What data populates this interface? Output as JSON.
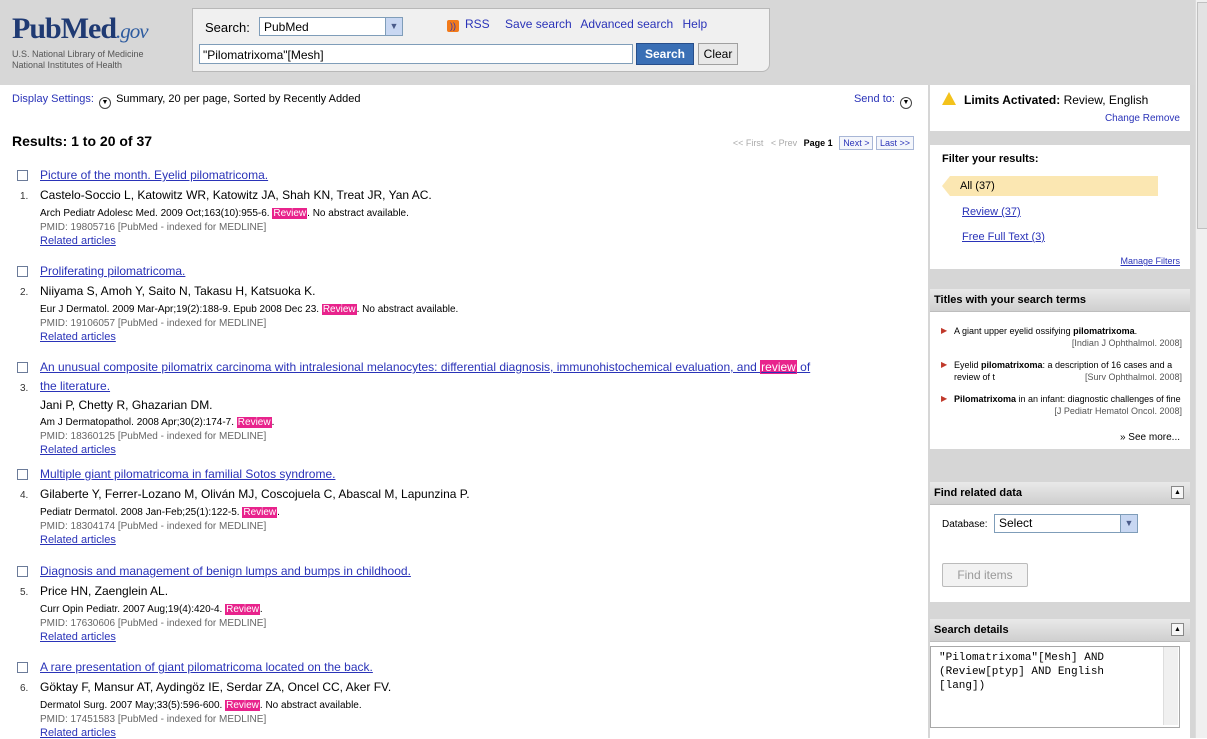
{
  "header": {
    "logo_pub": "Pub",
    "logo_med": "Med",
    "logo_gov": ".gov",
    "logo_sub1": "U.S. National Library of Medicine",
    "logo_sub2": "National Institutes of Health",
    "search_label": "Search:",
    "database": "PubMed",
    "links": [
      "RSS",
      "Save search",
      "Advanced search",
      "Help"
    ],
    "search_term": "\"Pilomatrixoma\"[Mesh]",
    "search_button": "Search",
    "clear_button": "Clear"
  },
  "display": {
    "settings_label": "Display Settings:",
    "settings_value": "Summary, 20 per page, Sorted by Recently Added",
    "send_to": "Send to:"
  },
  "results_heading": "Results: 1 to 20 of 37",
  "pager": {
    "first": "<< First",
    "prev": "< Prev",
    "page": "Page 1",
    "next": "Next >",
    "last": "Last >>"
  },
  "results": [
    {
      "num": "1.",
      "title": "Picture of the month. Eyelid pilomatricoma.",
      "authors": "Castelo-Soccio L, Katowitz WR, Katowitz JA, Shah KN, Treat JR, Yan AC.",
      "cite_pre": "Arch Pediatr Adolesc Med. 2009 Oct;163(10):955-6. ",
      "tag": "Review",
      "cite_post": ". No abstract available.",
      "pmid": "PMID: 19805716 [PubMed - indexed for MEDLINE]",
      "related": "Related articles"
    },
    {
      "num": "2.",
      "title": "Proliferating pilomatricoma.",
      "authors": "Niiyama S, Amoh Y, Saito N, Takasu H, Katsuoka K.",
      "cite_pre": "Eur J Dermatol. 2009 Mar-Apr;19(2):188-9. Epub 2008 Dec 23. ",
      "tag": "Review",
      "cite_post": ". No abstract available.",
      "pmid": "PMID: 19106057 [PubMed - indexed for MEDLINE]",
      "related": "Related articles"
    },
    {
      "num": "3.",
      "title_line1_pre": "An unusual composite pilomatrix carcinoma with intralesional melanocytes: differential diagnosis, immunohistochemical evaluation, and ",
      "title_line1_hl": "review",
      "title_line1_post": " of",
      "title_line2": "the literature.",
      "authors": "Jani P, Chetty R, Ghazarian DM.",
      "cite_pre": "Am J Dermatopathol. 2008 Apr;30(2):174-7. ",
      "tag": "Review",
      "cite_post": ".",
      "pmid": "PMID: 18360125 [PubMed - indexed for MEDLINE]",
      "related": "Related articles"
    },
    {
      "num": "4.",
      "title": "Multiple giant pilomatricoma in familial Sotos syndrome.",
      "authors": "Gilaberte Y, Ferrer-Lozano M, Oliván MJ, Coscojuela C, Abascal M, Lapunzina P.",
      "cite_pre": "Pediatr Dermatol. 2008 Jan-Feb;25(1):122-5. ",
      "tag": "Review",
      "cite_post": ".",
      "pmid": "PMID: 18304174 [PubMed - indexed for MEDLINE]",
      "related": "Related articles"
    },
    {
      "num": "5.",
      "title": "Diagnosis and management of benign lumps and bumps in childhood.",
      "authors": "Price HN, Zaenglein AL.",
      "cite_pre": "Curr Opin Pediatr. 2007 Aug;19(4):420-4. ",
      "tag": "Review",
      "cite_post": ".",
      "pmid": "PMID: 17630606 [PubMed - indexed for MEDLINE]",
      "related": "Related articles"
    },
    {
      "num": "6.",
      "title": "A rare presentation of giant pilomatricoma located on the back.",
      "authors": "Göktay F, Mansur AT, Aydingöz IE, Serdar ZA, Oncel CC, Aker FV.",
      "cite_pre": "Dermatol Surg. 2007 May;33(5):596-600. ",
      "tag": "Review",
      "cite_post": ". No abstract available.",
      "pmid": "PMID: 17451583 [PubMed - indexed for MEDLINE]",
      "related": "Related articles"
    }
  ],
  "sidebar": {
    "limits_label": "Limits Activated:",
    "limits_value": " Review, English",
    "limits_change": "Change",
    "limits_remove": "Remove",
    "filter_heading": "Filter your results:",
    "filter_all": "All (37)",
    "filter_review": "Review (37)",
    "filter_free": "Free Full Text (3)",
    "manage_filters": "Manage Filters",
    "titles_heading": "Titles with your search terms",
    "titles": [
      {
        "pre": "A giant upper eyelid ossifying ",
        "bold": "pilomatrixoma",
        "post": ".",
        "src": "[Indian J Ophthalmol. 2008]"
      },
      {
        "pre": "Eyelid ",
        "bold": "pilomatrixoma",
        "post": ": a description of 16 cases and a review of t",
        "src": "[Surv Ophthalmol. 2008]"
      },
      {
        "pre": "",
        "bold": "Pilomatrixoma",
        "post": " in an infant: diagnostic challenges of fine",
        "src": "[J Pediatr Hematol Oncol. 2008]"
      }
    ],
    "see_more": "» See more...",
    "related_heading": "Find related data",
    "database_label": "Database:",
    "database_value": "Select",
    "find_items": "Find items",
    "details_heading": "Search details",
    "details_text": "\"Pilomatrixoma\"[Mesh] AND\n(Review[ptyp] AND English\n[lang])"
  },
  "colors": {
    "highlight": "#e8238c",
    "link": "#2a33b8",
    "header_bg": "#d7d7d7"
  }
}
